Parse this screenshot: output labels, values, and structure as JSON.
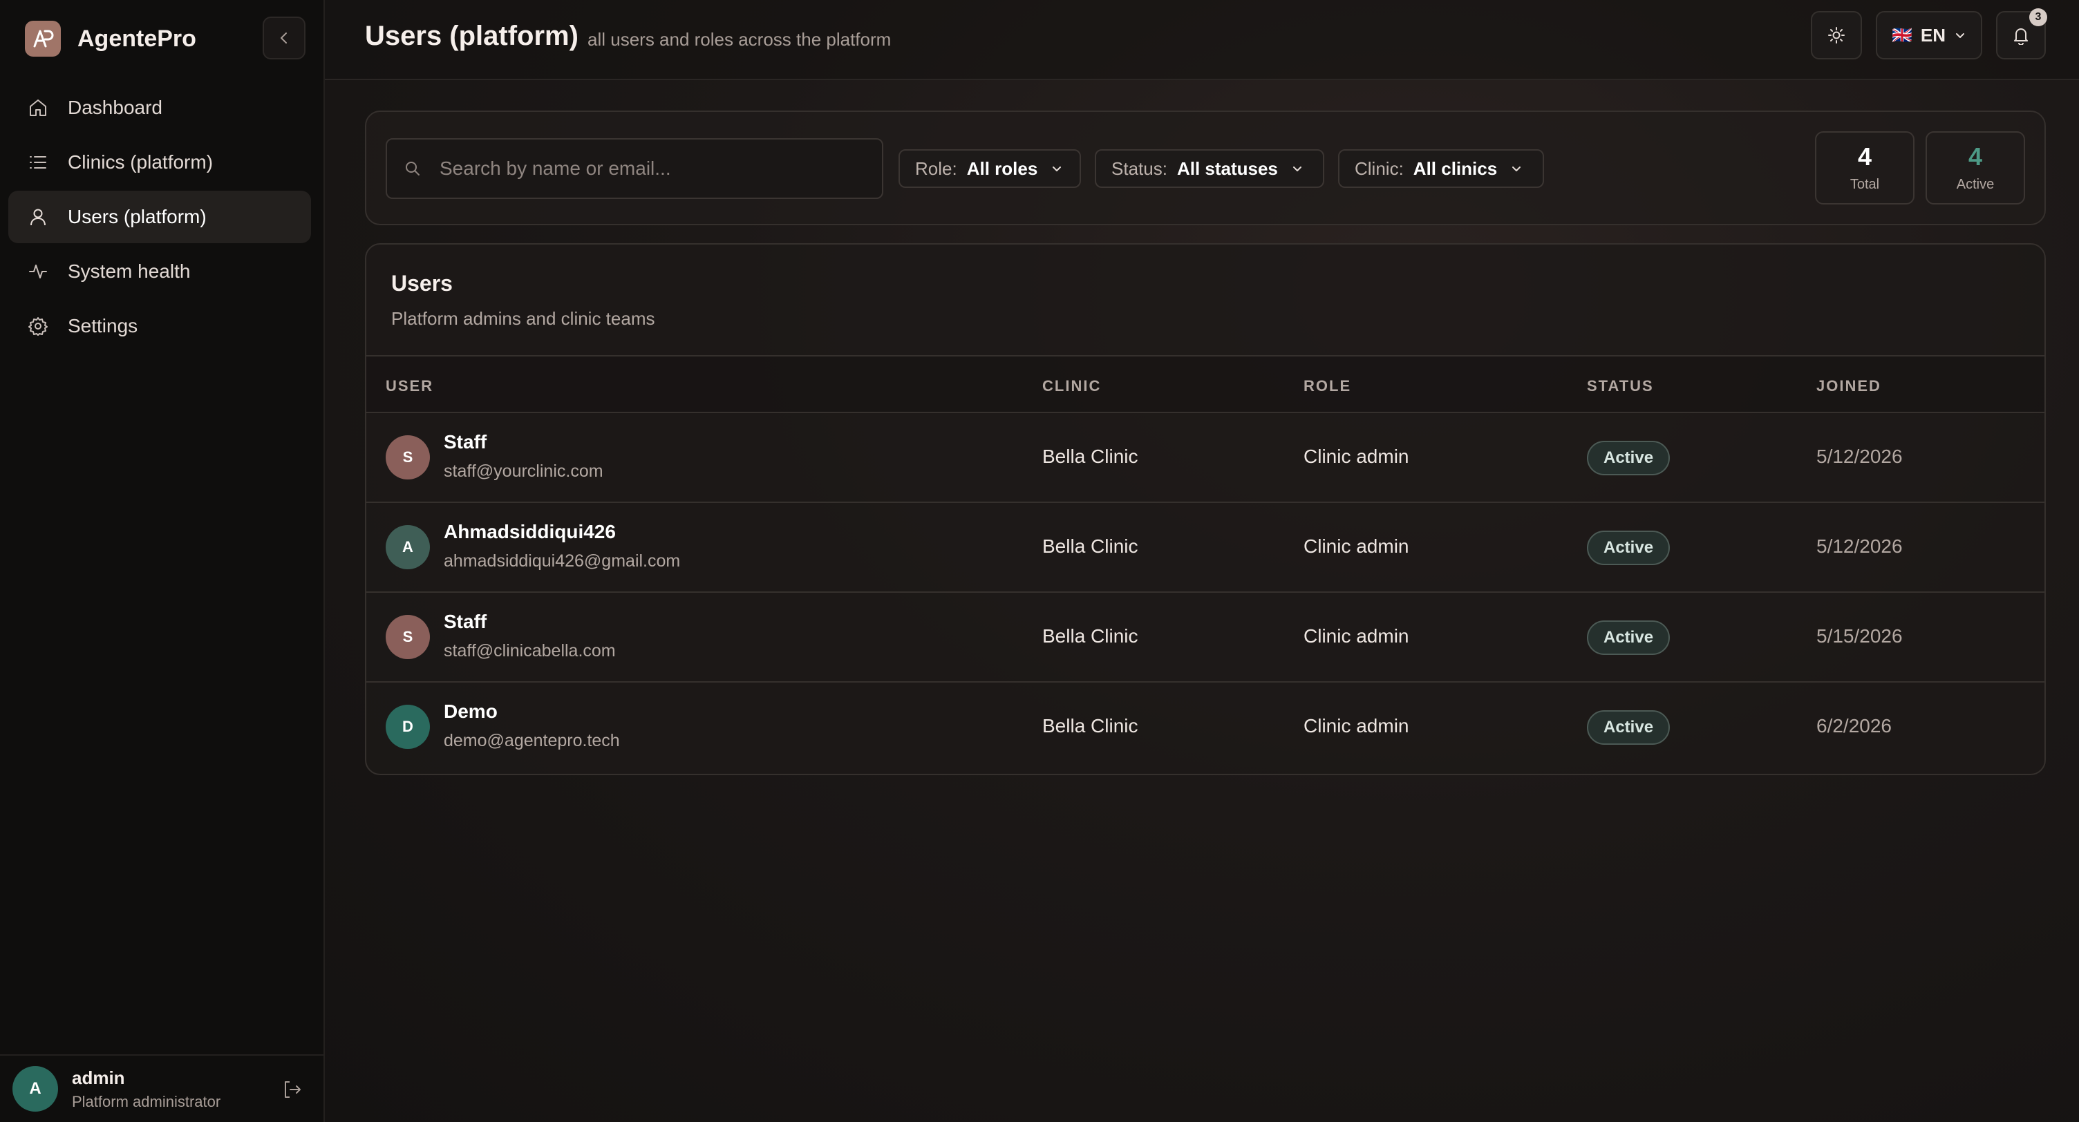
{
  "app": {
    "name": "AgentePro",
    "logo_text": "AP"
  },
  "sidebar": {
    "items": [
      {
        "label": "Dashboard",
        "icon": "home-icon",
        "active": false
      },
      {
        "label": "Clinics (platform)",
        "icon": "list-icon",
        "active": false
      },
      {
        "label": "Users (platform)",
        "icon": "user-icon",
        "active": true
      },
      {
        "label": "System health",
        "icon": "activity-icon",
        "active": false
      },
      {
        "label": "Settings",
        "icon": "gear-icon",
        "active": false
      }
    ],
    "footer": {
      "initial": "A",
      "name": "admin",
      "role": "Platform administrator"
    }
  },
  "header": {
    "title": "Users (platform)",
    "subtitle": "all users and roles across the platform",
    "language": "EN",
    "notifications_count": "3"
  },
  "filters": {
    "search_placeholder": "Search by name or email...",
    "role": {
      "label": "Role:",
      "value": "All roles"
    },
    "status": {
      "label": "Status:",
      "value": "All statuses"
    },
    "clinic": {
      "label": "Clinic:",
      "value": "All clinics"
    },
    "stats": {
      "total": {
        "value": "4",
        "label": "Total"
      },
      "active": {
        "value": "4",
        "label": "Active"
      }
    }
  },
  "users_table": {
    "title": "Users",
    "subtitle": "Platform admins and clinic teams",
    "columns": [
      "USER",
      "CLINIC",
      "ROLE",
      "STATUS",
      "JOINED"
    ],
    "rows": [
      {
        "initial": "S",
        "name": "Staff",
        "email": "staff@yourclinic.com",
        "clinic": "Bella Clinic",
        "role": "Clinic admin",
        "status": "Active",
        "joined": "5/12/2026",
        "avatar_color": "#8a5f5a"
      },
      {
        "initial": "A",
        "name": "Ahmadsiddiqui426",
        "email": "ahmadsiddiqui426@gmail.com",
        "clinic": "Bella Clinic",
        "role": "Clinic admin",
        "status": "Active",
        "joined": "5/12/2026",
        "avatar_color": "#3f5e56"
      },
      {
        "initial": "S",
        "name": "Staff",
        "email": "staff@clinicabella.com",
        "clinic": "Bella Clinic",
        "role": "Clinic admin",
        "status": "Active",
        "joined": "5/15/2026",
        "avatar_color": "#8a5f5a"
      },
      {
        "initial": "D",
        "name": "Demo",
        "email": "demo@agentepro.tech",
        "clinic": "Bella Clinic",
        "role": "Clinic admin",
        "status": "Active",
        "joined": "6/2/2026",
        "avatar_color": "#2a6a5e"
      }
    ]
  }
}
